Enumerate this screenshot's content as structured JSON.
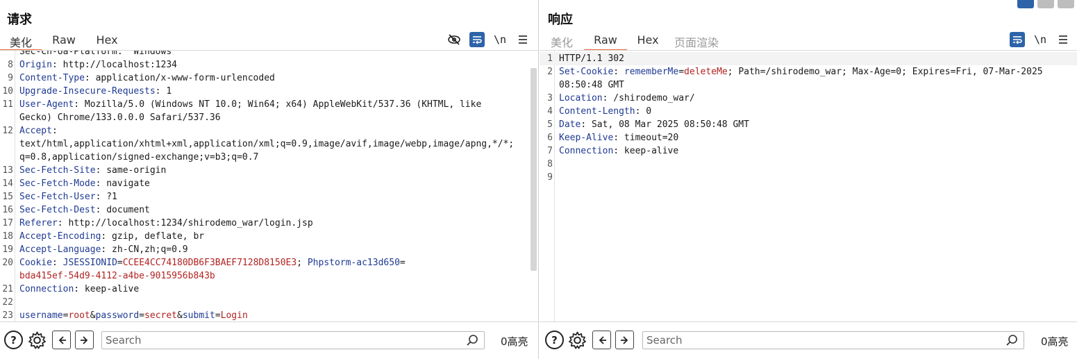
{
  "request": {
    "title": "请求",
    "tabs": [
      "美化",
      "Raw",
      "Hex"
    ],
    "active_tab": "美化",
    "toolbar": {
      "newline_label": "\\n"
    },
    "lines": [
      {
        "n": "",
        "parts": [
          {
            "t": "Sec-Ch-Ua-Platform: \"Windows\"",
            "c": "hv"
          }
        ]
      },
      {
        "n": "8",
        "parts": [
          {
            "t": "Origin",
            "c": "hk"
          },
          {
            "t": ": http://localhost:1234",
            "c": "hv"
          }
        ]
      },
      {
        "n": "9",
        "parts": [
          {
            "t": "Content-Type",
            "c": "hk"
          },
          {
            "t": ": application/x-www-form-urlencoded",
            "c": "hv"
          }
        ]
      },
      {
        "n": "10",
        "parts": [
          {
            "t": "Upgrade-Insecure-Requests",
            "c": "hk"
          },
          {
            "t": ": 1",
            "c": "hv"
          }
        ]
      },
      {
        "n": "11",
        "parts": [
          {
            "t": "User-Agent",
            "c": "hk"
          },
          {
            "t": ": Mozilla/5.0 (Windows NT 10.0; Win64; x64) AppleWebKit/537.36 (KHTML, like",
            "c": "hv"
          }
        ]
      },
      {
        "n": "",
        "parts": [
          {
            "t": "Gecko) Chrome/133.0.0.0 Safari/537.36",
            "c": "hv"
          }
        ]
      },
      {
        "n": "12",
        "parts": [
          {
            "t": "Accept",
            "c": "hk"
          },
          {
            "t": ":",
            "c": "hv"
          }
        ]
      },
      {
        "n": "",
        "parts": [
          {
            "t": "text/html,application/xhtml+xml,application/xml;q=0.9,image/avif,image/webp,image/apng,*/*;",
            "c": "hv"
          }
        ]
      },
      {
        "n": "",
        "parts": [
          {
            "t": "q=0.8,application/signed-exchange;v=b3;q=0.7",
            "c": "hv"
          }
        ]
      },
      {
        "n": "13",
        "parts": [
          {
            "t": "Sec-Fetch-Site",
            "c": "hk"
          },
          {
            "t": ": same-origin",
            "c": "hv"
          }
        ]
      },
      {
        "n": "14",
        "parts": [
          {
            "t": "Sec-Fetch-Mode",
            "c": "hk"
          },
          {
            "t": ": navigate",
            "c": "hv"
          }
        ]
      },
      {
        "n": "15",
        "parts": [
          {
            "t": "Sec-Fetch-User",
            "c": "hk"
          },
          {
            "t": ": ?1",
            "c": "hv"
          }
        ]
      },
      {
        "n": "16",
        "parts": [
          {
            "t": "Sec-Fetch-Dest",
            "c": "hk"
          },
          {
            "t": ": document",
            "c": "hv"
          }
        ]
      },
      {
        "n": "17",
        "parts": [
          {
            "t": "Referer",
            "c": "hk"
          },
          {
            "t": ": http://localhost:1234/shirodemo_war/login.jsp",
            "c": "hv"
          }
        ]
      },
      {
        "n": "18",
        "parts": [
          {
            "t": "Accept-Encoding",
            "c": "hk"
          },
          {
            "t": ": gzip, deflate, br",
            "c": "hv"
          }
        ]
      },
      {
        "n": "19",
        "parts": [
          {
            "t": "Accept-Language",
            "c": "hk"
          },
          {
            "t": ": zh-CN,zh;q=0.9",
            "c": "hv"
          }
        ]
      },
      {
        "n": "20",
        "parts": [
          {
            "t": "Cookie",
            "c": "hk"
          },
          {
            "t": ": ",
            "c": "hv"
          },
          {
            "t": "JSESSIONID",
            "c": "pk"
          },
          {
            "t": "=",
            "c": "op"
          },
          {
            "t": "CCEE4CC74180DB6F3BAEF7128D8150E3",
            "c": "pv"
          },
          {
            "t": "; ",
            "c": "op"
          },
          {
            "t": "Phpstorm-ac13d650",
            "c": "pk"
          },
          {
            "t": "=",
            "c": "op"
          }
        ]
      },
      {
        "n": "",
        "parts": [
          {
            "t": "bda415ef-54d9-4112-a4be-9015956b843b",
            "c": "pv"
          }
        ]
      },
      {
        "n": "21",
        "parts": [
          {
            "t": "Connection",
            "c": "hk"
          },
          {
            "t": ": keep-alive",
            "c": "hv"
          }
        ]
      },
      {
        "n": "22",
        "parts": []
      },
      {
        "n": "23",
        "parts": [
          {
            "t": "username",
            "c": "pk"
          },
          {
            "t": "=",
            "c": "op"
          },
          {
            "t": "root",
            "c": "pv"
          },
          {
            "t": "&",
            "c": "op"
          },
          {
            "t": "password",
            "c": "pk"
          },
          {
            "t": "=",
            "c": "op"
          },
          {
            "t": "secret",
            "c": "pv"
          },
          {
            "t": "&",
            "c": "op"
          },
          {
            "t": "submit",
            "c": "pk"
          },
          {
            "t": "=",
            "c": "op"
          },
          {
            "t": "Login",
            "c": "pv"
          }
        ]
      }
    ],
    "search_placeholder": "Search",
    "matches_label": "0高亮"
  },
  "response": {
    "title": "响应",
    "tabs": [
      "美化",
      "Raw",
      "Hex",
      "页面渲染"
    ],
    "active_tab": "Raw",
    "toolbar": {
      "newline_label": "\\n"
    },
    "lines": [
      {
        "n": "1",
        "parts": [
          {
            "t": "HTTP/1.1 302",
            "c": "hv"
          }
        ],
        "hl": true
      },
      {
        "n": "2",
        "parts": [
          {
            "t": "Set-Cookie",
            "c": "hk"
          },
          {
            "t": ": ",
            "c": "hv"
          },
          {
            "t": "rememberMe",
            "c": "pk"
          },
          {
            "t": "=",
            "c": "op"
          },
          {
            "t": "deleteMe",
            "c": "pv"
          },
          {
            "t": "; Path=/shirodemo_war; Max-Age=0; Expires=Fri, 07-Mar-2025",
            "c": "hv"
          }
        ]
      },
      {
        "n": "",
        "parts": [
          {
            "t": "08:50:48 GMT",
            "c": "hv"
          }
        ]
      },
      {
        "n": "3",
        "parts": [
          {
            "t": "Location",
            "c": "hk"
          },
          {
            "t": ": /shirodemo_war/",
            "c": "hv"
          }
        ]
      },
      {
        "n": "4",
        "parts": [
          {
            "t": "Content-Length",
            "c": "hk"
          },
          {
            "t": ": 0",
            "c": "hv"
          }
        ]
      },
      {
        "n": "5",
        "parts": [
          {
            "t": "Date",
            "c": "hk"
          },
          {
            "t": ": Sat, 08 Mar 2025 08:50:48 GMT",
            "c": "hv"
          }
        ]
      },
      {
        "n": "6",
        "parts": [
          {
            "t": "Keep-Alive",
            "c": "hk"
          },
          {
            "t": ": timeout=20",
            "c": "hv"
          }
        ]
      },
      {
        "n": "7",
        "parts": [
          {
            "t": "Connection",
            "c": "hk"
          },
          {
            "t": ": keep-alive",
            "c": "hv"
          }
        ]
      },
      {
        "n": "8",
        "parts": []
      },
      {
        "n": "9",
        "parts": []
      }
    ],
    "search_placeholder": "Search",
    "matches_label": "0高亮"
  },
  "colors": {
    "accent_tab": "#e8683a",
    "header_key": "#1f3a93",
    "param_value": "#b22222",
    "toolbar_button_blue": "#2d63a8"
  }
}
